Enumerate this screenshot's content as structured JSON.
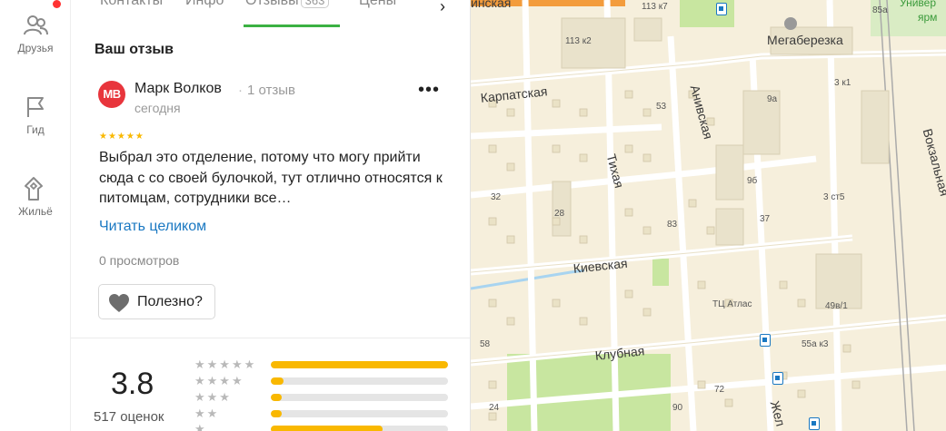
{
  "rail": {
    "items": [
      {
        "label": "Друзья",
        "icon": "friends-icon"
      },
      {
        "label": "Гид",
        "icon": "flag-icon"
      },
      {
        "label": "Жильё",
        "icon": "house-hand-icon"
      }
    ]
  },
  "tabs": {
    "items": [
      {
        "label": "Контакты"
      },
      {
        "label": "Инфо"
      },
      {
        "label": "Отзывы",
        "count": "363",
        "active": true
      },
      {
        "label": "Цены"
      }
    ],
    "next_icon": "chevron-right-icon"
  },
  "review": {
    "section_title": "Ваш отзыв",
    "avatar_initials": "МВ",
    "author": "Марк Волков",
    "author_reviews": "1 отзыв",
    "date": "сегодня",
    "stars": "★★★★★",
    "text": "Выбрал это отделение, потому что могу прийти сюда с со своей булочкой, тут отлично относятся к питомцам, сотрудники все…",
    "read_more": "Читать целиком",
    "views": "0 просмотров",
    "useful_label": "Полезно?",
    "more_icon": "more-dots-icon",
    "useful_icon": "heart-icon"
  },
  "rating": {
    "value": "3.8",
    "count_label": "517 оценок",
    "distribution": [
      {
        "stars": "★★★★★",
        "fraction": 1.0
      },
      {
        "stars": "★★★★",
        "fraction": 0.07
      },
      {
        "stars": "★★★",
        "fraction": 0.06
      },
      {
        "stars": "★★",
        "fraction": 0.06
      },
      {
        "stars": "★",
        "fraction": 0.63
      }
    ]
  },
  "map": {
    "labels": {
      "top_left": "инская",
      "university": "Универ",
      "university2": "ярм",
      "b113k7": "113 к7",
      "b85a": "85а",
      "megaberezka": "Мегаберезка",
      "b113k2": "113 к2",
      "karpatskaya": "Карпатская",
      "anivskaya": "Анивская",
      "b3k1": "3 к1",
      "b9a": "9а",
      "b53": "53",
      "vokzalnaya": "Вокзальная",
      "tikhaya": "Тихая",
      "b9b": "9б",
      "b3st5": "3 ст5",
      "b32": "32",
      "b28": "28",
      "b37": "37",
      "b83": "83",
      "kievskaya": "Киевская",
      "tc_atlas": "ТЦ Атлас",
      "b49v1": "49в/1",
      "b58": "58",
      "klubnaya": "Клубная",
      "b55ak3": "55а к3",
      "b72": "72",
      "b24": "24",
      "b90": "90",
      "zhel": "Жел"
    },
    "colors": {
      "background": "#f6efdc",
      "road": "#ffffff",
      "park": "#c8e6a0",
      "water": "#a8d4f0",
      "building": "#e9e2cb"
    }
  }
}
